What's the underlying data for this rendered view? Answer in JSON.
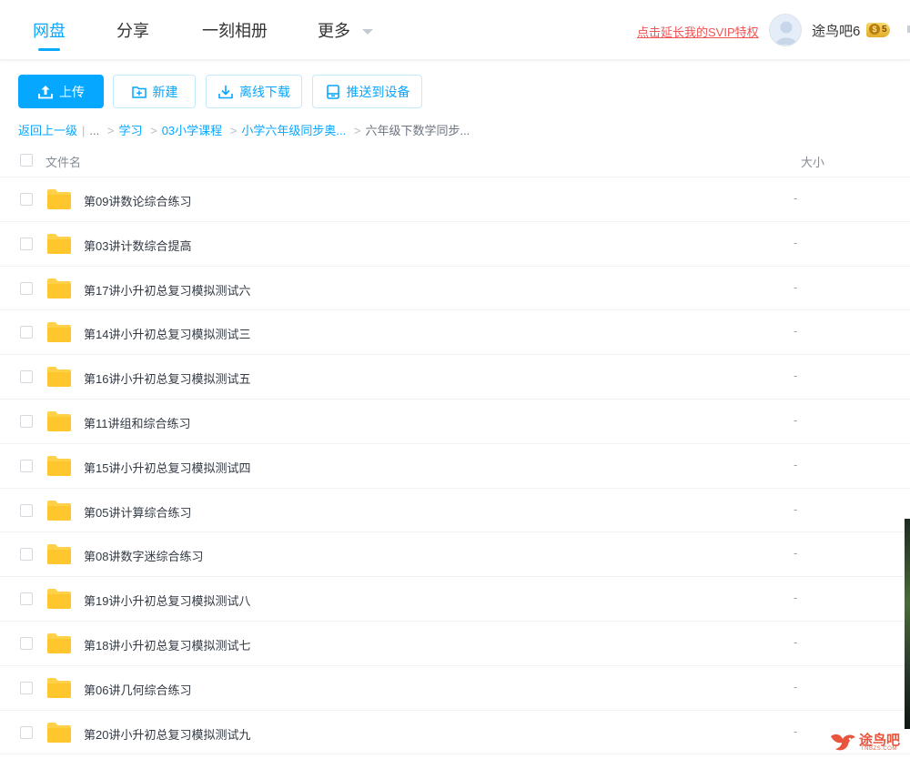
{
  "nav": {
    "tabs": [
      {
        "label": "网盘"
      },
      {
        "label": "分享"
      },
      {
        "label": "一刻相册"
      },
      {
        "label": "更多"
      }
    ],
    "svip_link": "点击延长我的SVIP特权",
    "username": "途鸟吧6",
    "vip_level": "5",
    "accent_color": "#09aaff"
  },
  "toolbar": {
    "upload": "上传",
    "new": "新建",
    "offline_download": "离线下载",
    "push_to_device": "推送到设备"
  },
  "breadcrumb": {
    "back": "返回上一级",
    "ellipsis": "...",
    "items": [
      "学习",
      "03小学课程",
      "小学六年级同步奥..."
    ],
    "current": "六年级下数学同步..."
  },
  "table": {
    "col_name": "文件名",
    "col_size": "大小",
    "rows": [
      {
        "name": "第09讲数论综合练习",
        "size": "-"
      },
      {
        "name": "第03讲计数综合提高",
        "size": "-"
      },
      {
        "name": "第17讲小升初总复习模拟测试六",
        "size": "-"
      },
      {
        "name": "第14讲小升初总复习模拟测试三",
        "size": "-"
      },
      {
        "name": "第16讲小升初总复习模拟测试五",
        "size": "-"
      },
      {
        "name": "第11讲组和综合练习",
        "size": "-"
      },
      {
        "name": "第15讲小升初总复习模拟测试四",
        "size": "-"
      },
      {
        "name": "第05讲计算综合练习",
        "size": "-"
      },
      {
        "name": "第08讲数字迷综合练习",
        "size": "-"
      },
      {
        "name": "第19讲小升初总复习模拟测试八",
        "size": "-"
      },
      {
        "name": "第18讲小升初总复习模拟测试七",
        "size": "-"
      },
      {
        "name": "第06讲几何综合练习",
        "size": "-"
      },
      {
        "name": "第20讲小升初总复习模拟测试九",
        "size": "-"
      }
    ]
  },
  "watermark": {
    "text": "途鸟吧",
    "sub": "TNBZS.COM"
  }
}
